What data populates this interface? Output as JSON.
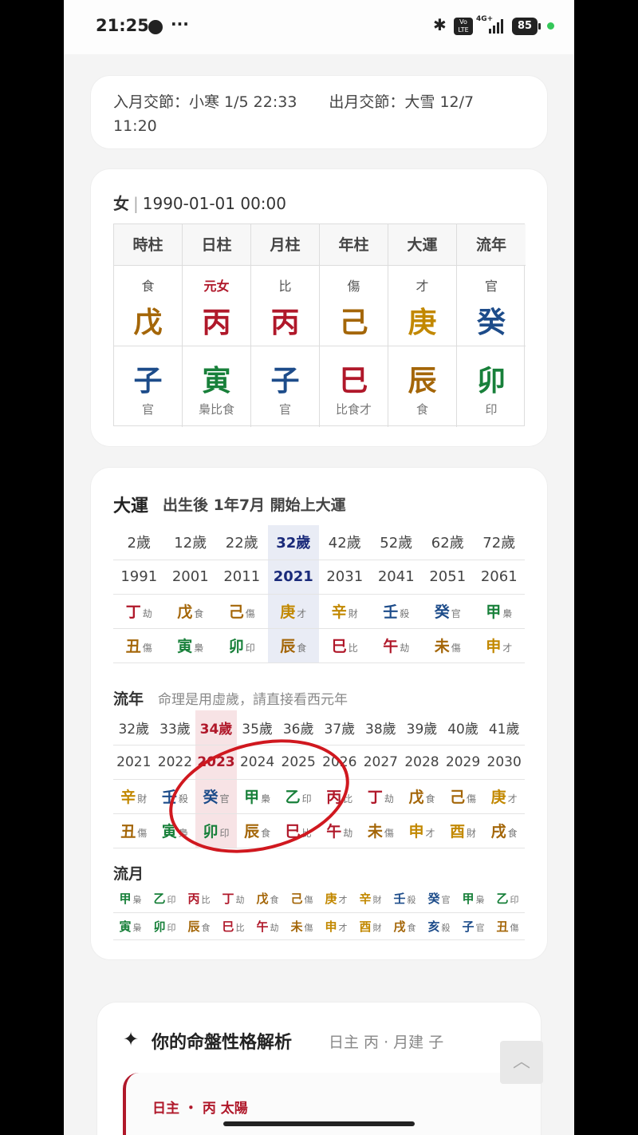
{
  "status_bar": {
    "time": "21:25",
    "dots": "···",
    "bluetooth": "✱",
    "volte": "Vo LTE",
    "network": "4G+",
    "battery": "85"
  },
  "jieqi": {
    "in_label": "入月交節：小寒 1/5 22:33",
    "out_label": "出月交節：大雪 12/7",
    "out_time": "11:20"
  },
  "bazi": {
    "gender": "女",
    "separator": "|",
    "birth": "1990-01-01 00:00",
    "pillars": [
      {
        "label": "時柱",
        "god": "食",
        "gan": "戊",
        "gan_el": "earth",
        "zhi": "子",
        "zhi_el": "water",
        "hidden": "官"
      },
      {
        "label": "日柱",
        "god": "元女",
        "gan": "丙",
        "gan_el": "fire",
        "zhi": "寅",
        "zhi_el": "wood",
        "hidden": "梟比食"
      },
      {
        "label": "月柱",
        "god": "比",
        "gan": "丙",
        "gan_el": "fire",
        "zhi": "子",
        "zhi_el": "water",
        "hidden": "官"
      },
      {
        "label": "年柱",
        "god": "傷",
        "gan": "己",
        "gan_el": "earth",
        "zhi": "巳",
        "zhi_el": "fire",
        "hidden": "比食才"
      },
      {
        "label": "大運",
        "god": "才",
        "gan": "庚",
        "gan_el": "metal",
        "zhi": "辰",
        "zhi_el": "earth",
        "hidden": "食"
      },
      {
        "label": "流年",
        "god": "官",
        "gan": "癸",
        "gan_el": "water",
        "zhi": "卯",
        "zhi_el": "wood",
        "hidden": "印"
      }
    ]
  },
  "dayun": {
    "title": "大運",
    "subtitle": "出生後 1年7月 開始上大運",
    "current_index": 3,
    "ages": [
      "2歲",
      "12歲",
      "22歲",
      "32歲",
      "42歲",
      "52歲",
      "62歲",
      "72歲"
    ],
    "years": [
      "1991",
      "2001",
      "2011",
      "2021",
      "2031",
      "2041",
      "2051",
      "2061"
    ],
    "gan": [
      [
        "丁",
        "劫",
        "fire"
      ],
      [
        "戊",
        "食",
        "earth"
      ],
      [
        "己",
        "傷",
        "earth"
      ],
      [
        "庚",
        "才",
        "metal"
      ],
      [
        "辛",
        "財",
        "metal"
      ],
      [
        "壬",
        "殺",
        "water"
      ],
      [
        "癸",
        "官",
        "water"
      ],
      [
        "甲",
        "梟",
        "wood"
      ]
    ],
    "zhi": [
      [
        "丑",
        "傷",
        "earth"
      ],
      [
        "寅",
        "梟",
        "wood"
      ],
      [
        "卯",
        "印",
        "wood"
      ],
      [
        "辰",
        "食",
        "earth"
      ],
      [
        "巳",
        "比",
        "fire"
      ],
      [
        "午",
        "劫",
        "fire"
      ],
      [
        "未",
        "傷",
        "earth"
      ],
      [
        "申",
        "才",
        "metal"
      ]
    ]
  },
  "liunian": {
    "title": "流年",
    "note": "命理是用虛歲，請直接看西元年",
    "current_index": 2,
    "ages": [
      "32歲",
      "33歲",
      "34歲",
      "35歲",
      "36歲",
      "37歲",
      "38歲",
      "39歲",
      "40歲",
      "41歲"
    ],
    "years": [
      "2021",
      "2022",
      "2023",
      "2024",
      "2025",
      "2026",
      "2027",
      "2028",
      "2029",
      "2030"
    ],
    "gan": [
      [
        "辛",
        "財",
        "metal"
      ],
      [
        "壬",
        "殺",
        "water"
      ],
      [
        "癸",
        "官",
        "water"
      ],
      [
        "甲",
        "梟",
        "wood"
      ],
      [
        "乙",
        "印",
        "wood"
      ],
      [
        "丙",
        "比",
        "fire"
      ],
      [
        "丁",
        "劫",
        "fire"
      ],
      [
        "戊",
        "食",
        "earth"
      ],
      [
        "己",
        "傷",
        "earth"
      ],
      [
        "庚",
        "才",
        "metal"
      ]
    ],
    "zhi": [
      [
        "丑",
        "傷",
        "earth"
      ],
      [
        "寅",
        "梟",
        "wood"
      ],
      [
        "卯",
        "印",
        "wood"
      ],
      [
        "辰",
        "食",
        "earth"
      ],
      [
        "巳",
        "比",
        "fire"
      ],
      [
        "午",
        "劫",
        "fire"
      ],
      [
        "未",
        "傷",
        "earth"
      ],
      [
        "申",
        "才",
        "metal"
      ],
      [
        "酉",
        "財",
        "metal"
      ],
      [
        "戌",
        "食",
        "earth"
      ]
    ]
  },
  "liuyue": {
    "title": "流月",
    "gan": [
      [
        "甲",
        "梟",
        "wood"
      ],
      [
        "乙",
        "印",
        "wood"
      ],
      [
        "丙",
        "比",
        "fire"
      ],
      [
        "丁",
        "劫",
        "fire"
      ],
      [
        "戊",
        "食",
        "earth"
      ],
      [
        "己",
        "傷",
        "earth"
      ],
      [
        "庚",
        "才",
        "metal"
      ],
      [
        "辛",
        "財",
        "metal"
      ],
      [
        "壬",
        "殺",
        "water"
      ],
      [
        "癸",
        "官",
        "water"
      ],
      [
        "甲",
        "梟",
        "wood"
      ],
      [
        "乙",
        "印",
        "wood"
      ]
    ],
    "zhi": [
      [
        "寅",
        "梟",
        "wood"
      ],
      [
        "卯",
        "印",
        "wood"
      ],
      [
        "辰",
        "食",
        "earth"
      ],
      [
        "巳",
        "比",
        "fire"
      ],
      [
        "午",
        "劫",
        "fire"
      ],
      [
        "未",
        "傷",
        "earth"
      ],
      [
        "申",
        "才",
        "metal"
      ],
      [
        "酉",
        "財",
        "metal"
      ],
      [
        "戌",
        "食",
        "earth"
      ],
      [
        "亥",
        "殺",
        "water"
      ],
      [
        "子",
        "官",
        "water"
      ],
      [
        "丑",
        "傷",
        "earth"
      ]
    ]
  },
  "analysis": {
    "star": "✦",
    "title": "你的命盤性格解析",
    "subtitle": "日主 丙 · 月建 子",
    "section": "日主 ・ 丙 太陽"
  },
  "scroll_top_icon": "︿",
  "colors": {
    "fire": "#b0182a",
    "earth": "#a46608",
    "metal": "#c28800",
    "water": "#1d4c8a",
    "wood": "#18803a",
    "annotation_circle": "#d0181f"
  }
}
